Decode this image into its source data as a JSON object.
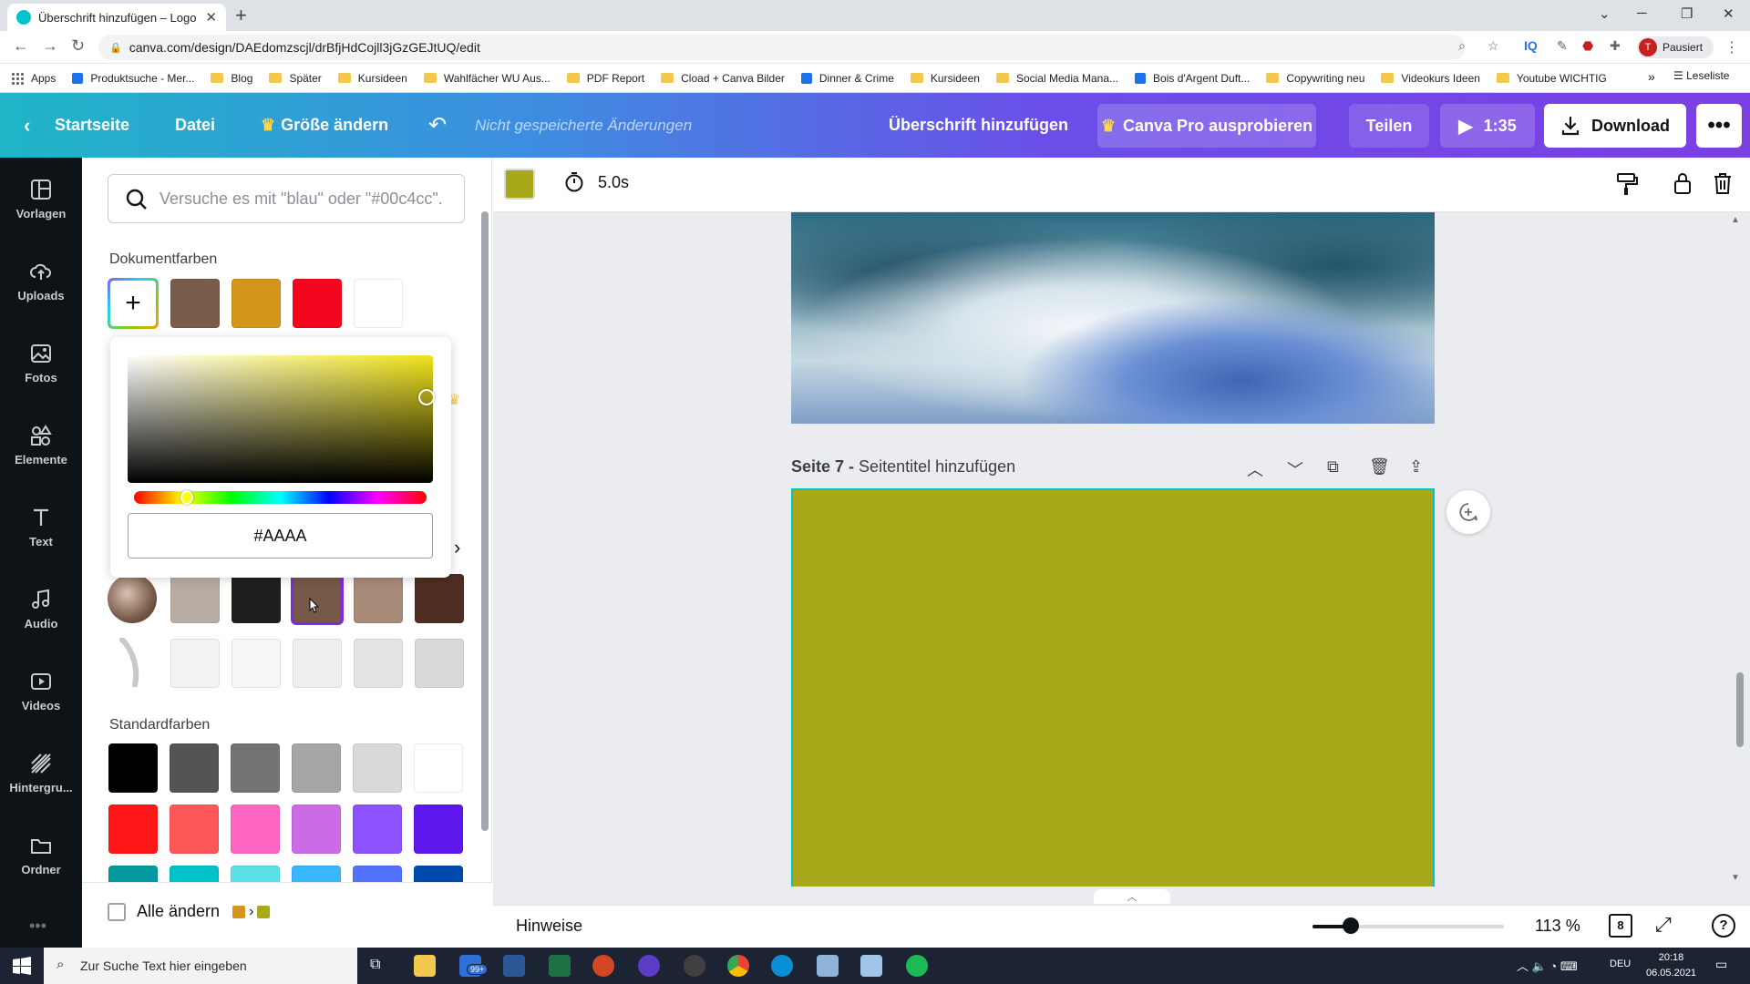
{
  "browser": {
    "tab_title": "Überschrift hinzufügen – Logo",
    "url": "canva.com/design/DAEdomzscjl/drBfjHdCojll3jGzGEJtUQ/edit",
    "profile_label": "Pausiert",
    "profile_initial": "T",
    "bookmarks": [
      {
        "label": "Apps",
        "icon": "apps-grid-icon"
      },
      {
        "label": "Produktsuche - Mer...",
        "icon": "bookmark-icon"
      },
      {
        "label": "Blog",
        "icon": "folder-icon"
      },
      {
        "label": "Später",
        "icon": "folder-icon"
      },
      {
        "label": "Kursideen",
        "icon": "folder-icon"
      },
      {
        "label": "Wahlfächer WU Aus...",
        "icon": "folder-icon"
      },
      {
        "label": "PDF Report",
        "icon": "folder-icon"
      },
      {
        "label": "Cload + Canva Bilder",
        "icon": "folder-icon"
      },
      {
        "label": "Dinner & Crime",
        "icon": "bookmark-icon"
      },
      {
        "label": "Kursideen",
        "icon": "folder-icon"
      },
      {
        "label": "Social Media Mana...",
        "icon": "folder-icon"
      },
      {
        "label": "Bois d'Argent Duft...",
        "icon": "bookmark-icon"
      },
      {
        "label": "Copywriting neu",
        "icon": "folder-icon"
      },
      {
        "label": "Videokurs Ideen",
        "icon": "folder-icon"
      },
      {
        "label": "Youtube WICHTIG",
        "icon": "folder-icon"
      }
    ],
    "more_bookmarks": "»",
    "reading_list": "Leseliste"
  },
  "canva_header": {
    "home": "Startseite",
    "file": "Datei",
    "resize": "Größe ändern",
    "unsaved": "Nicht gespeicherte Änderungen",
    "doc_title": "Überschrift hinzufügen",
    "pro": "Canva Pro ausprobieren",
    "share": "Teilen",
    "play_time": "1:35",
    "download": "Download",
    "more": "•••"
  },
  "rail": [
    {
      "label": "Vorlagen",
      "icon": "templates-icon"
    },
    {
      "label": "Uploads",
      "icon": "upload-cloud-icon"
    },
    {
      "label": "Fotos",
      "icon": "photo-icon"
    },
    {
      "label": "Elemente",
      "icon": "elements-icon"
    },
    {
      "label": "Text",
      "icon": "text-icon"
    },
    {
      "label": "Audio",
      "icon": "music-note-icon"
    },
    {
      "label": "Videos",
      "icon": "video-icon"
    },
    {
      "label": "Hintergru...",
      "icon": "background-icon"
    },
    {
      "label": "Ordner",
      "icon": "folder-icon"
    }
  ],
  "color_panel": {
    "search_placeholder": "Versuche es mit \"blau\" oder \"#00c4cc\".",
    "doc_colors_title": "Dokumentfarben",
    "doc_colors": [
      "#7a5c4b",
      "#d4951c",
      "#f3071e",
      "#ffffff"
    ],
    "hex_value": "#AAAA",
    "photo_colors_row1": [
      "#b9aca3",
      "#1f1f20",
      "#77594a",
      "#a88a79",
      "#4f2d22"
    ],
    "photo_colors_row2": [
      "#f3f3f3",
      "#f6f6f6",
      "#efefef",
      "#e4e4e4",
      "#d9d9d9"
    ],
    "standard_title": "Standardfarben",
    "standard_row1": [
      "#000000",
      "#545454",
      "#737373",
      "#a6a6a6",
      "#d9d9d9",
      "#ffffff"
    ],
    "standard_row2": [
      "#ff1616",
      "#ff5757",
      "#ff66c4",
      "#cb6ce6",
      "#8c52ff",
      "#5e17eb"
    ],
    "standard_row3": [
      "#03989e",
      "#00c2cb",
      "#5ce1e6",
      "#38b6ff",
      "#5271ff",
      "#004aad"
    ],
    "change_all": "Alle ändern",
    "change_from": "#d4951c",
    "change_to": "#a8a81a"
  },
  "toolbar": {
    "selected_color": "#a8a81a",
    "duration": "5.0s"
  },
  "canvas": {
    "page_label": "Seite 7 -",
    "page_title_placeholder": "Seitentitel hinzufügen",
    "page_fill": "#a8a81a"
  },
  "bottom": {
    "notes": "Hinweise",
    "zoom": "113 %",
    "zoom_fraction": 0.2,
    "page_count": "8"
  },
  "taskbar": {
    "search_placeholder": "Zur Suche Text hier eingeben",
    "badge": "99+",
    "lang": "DEU",
    "time": "20:18",
    "date": "06.05.2021"
  }
}
